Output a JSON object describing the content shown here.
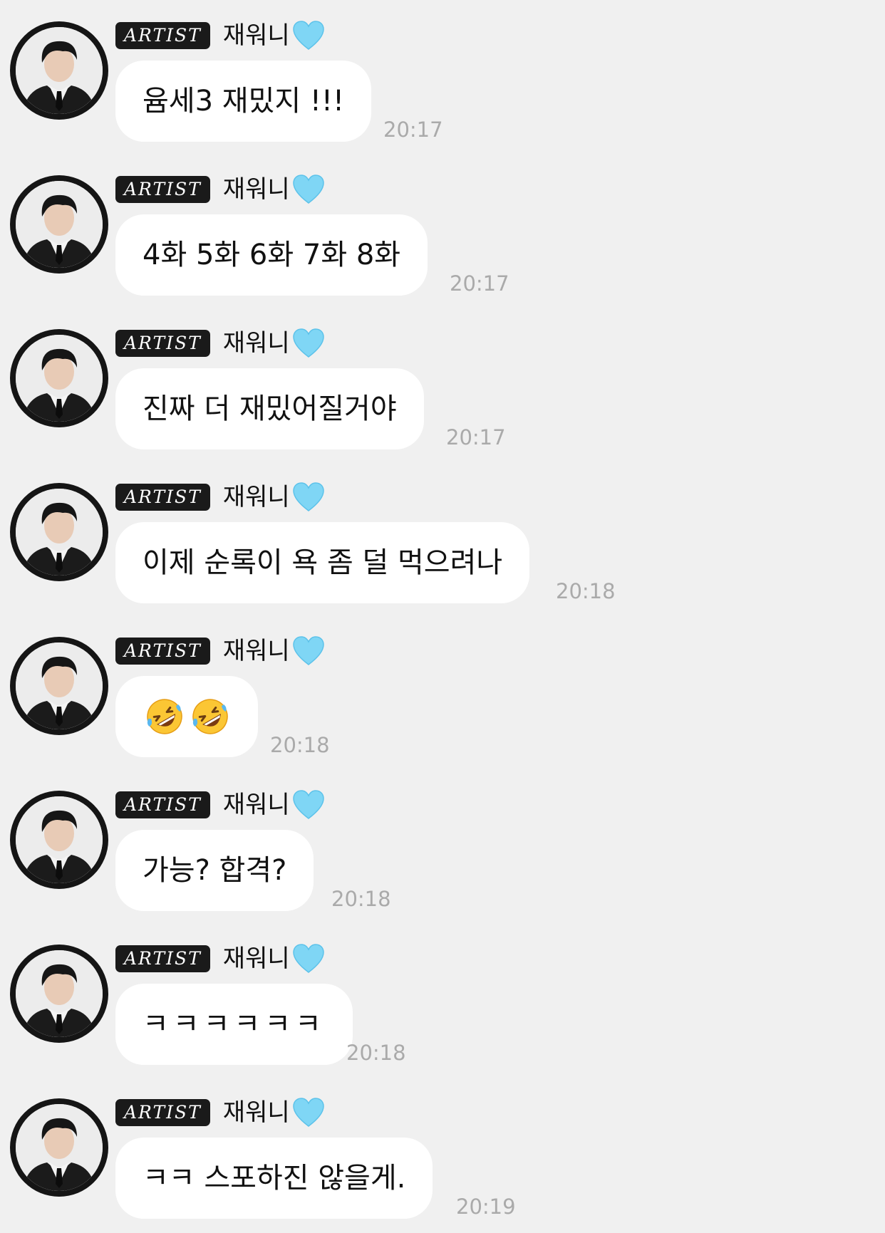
{
  "colors": {
    "background": "#f0f0f0",
    "bubble": "#ffffff",
    "badge": "#1a1a1a",
    "heart": "#7fd6f5",
    "time": "#aaaaaa"
  },
  "sender": {
    "badge": "ARTIST",
    "name": "재워니",
    "name_icon": "light-blue-heart-icon",
    "avatar_icon": "profile-photo-man-in-black-suit"
  },
  "messages": [
    {
      "text": "윰세3 재밌지 !!!",
      "time": "20:17"
    },
    {
      "text": "4화 5화 6화 7화 8화",
      "time": "20:17"
    },
    {
      "text": "진짜 더 재밌어질거야",
      "time": "20:17"
    },
    {
      "text": "이제 순록이 욕 좀 덜 먹으려나",
      "time": "20:18"
    },
    {
      "text": "",
      "emoji": [
        "rolling-on-floor-laughing-icon",
        "rolling-on-floor-laughing-icon"
      ],
      "time": "20:18"
    },
    {
      "text": "가능? 합격?",
      "time": "20:18"
    },
    {
      "text": "ㅋㅋㅋㅋㅋㅋ",
      "time": "20:18"
    },
    {
      "text": "ㅋㅋ 스포하진 않을게.",
      "time": "20:19"
    }
  ]
}
